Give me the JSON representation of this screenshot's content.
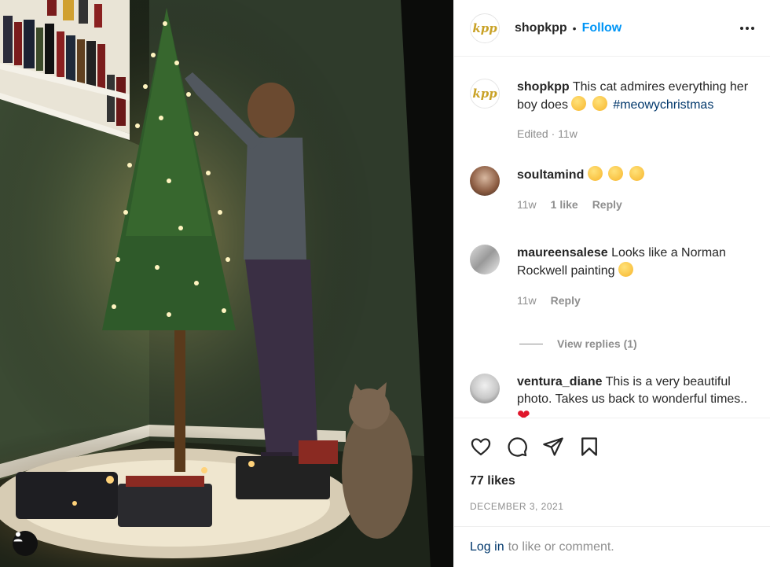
{
  "post": {
    "image_alt": "Boy decorating a lit Christmas tree while a cat watches beside a toy train"
  },
  "header": {
    "username": "shopkpp",
    "separator": "•",
    "follow_label": "Follow",
    "logo_text": "kpp"
  },
  "caption": {
    "username": "shopkpp",
    "text": "This cat admires everything her boy does",
    "hashtag": "#meowychristmas",
    "edited": "Edited",
    "age": "11w"
  },
  "comments": [
    {
      "username": "soultamind",
      "text": "",
      "age": "11w",
      "likes": "1 like",
      "reply_label": "Reply"
    },
    {
      "username": "maureensalese",
      "text": "Looks like a Norman Rockwell painting",
      "age": "11w",
      "reply_label": "Reply",
      "view_replies": "View replies (1)"
    },
    {
      "username": "ventura_diane",
      "text": "This is a very beautiful photo. Takes us back to wonderful times.."
    }
  ],
  "engagement": {
    "likes": "77 likes",
    "date": "DECEMBER 3, 2021"
  },
  "footer": {
    "login_label": "Log in",
    "login_suffix": "to like or comment."
  },
  "icons": {
    "like": "heart-icon",
    "comment": "comment-icon",
    "share": "paper-plane-icon",
    "save": "bookmark-icon",
    "more": "more-options-icon",
    "tag": "user-tag-icon"
  },
  "colors": {
    "accent": "#0095f6",
    "hashtag": "#00376b",
    "muted": "#8e8e8e",
    "text": "#262626"
  }
}
